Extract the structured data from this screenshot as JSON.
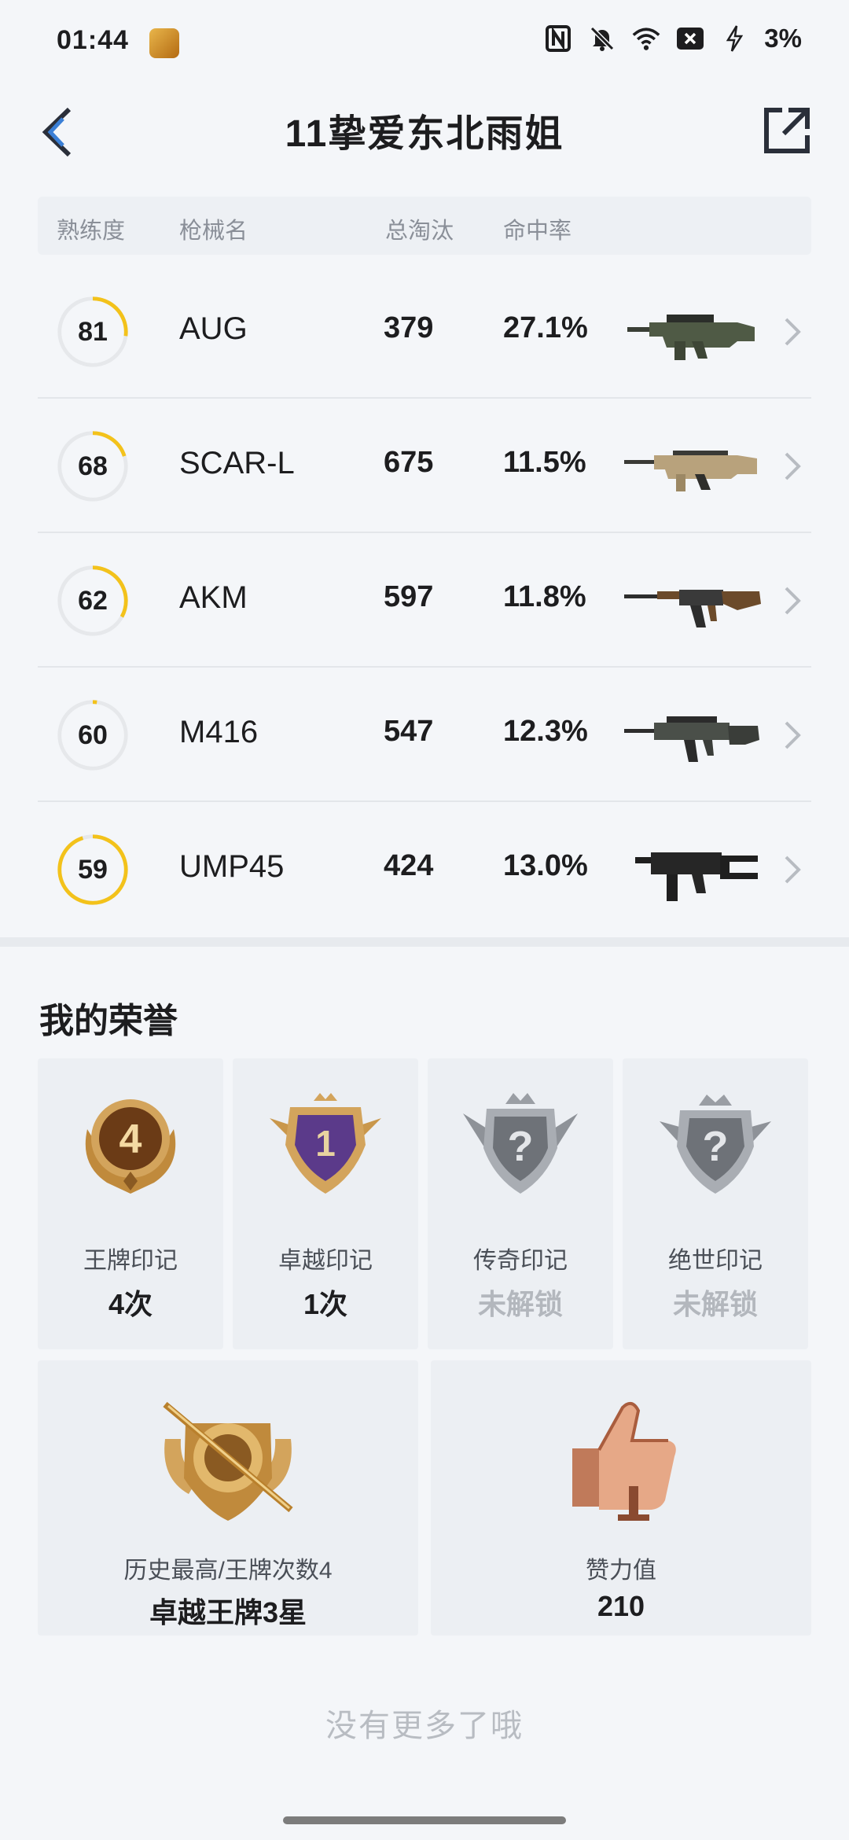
{
  "status_bar": {
    "time": "01:44",
    "battery": "3%",
    "icons": [
      "app-icon",
      "nfc-icon",
      "mute-icon",
      "wifi-icon",
      "sim-off-icon",
      "charging-icon"
    ]
  },
  "header": {
    "title": "11挚爱东北雨姐",
    "back_icon": "back-arrow-icon",
    "share_icon": "share-icon"
  },
  "weapon_table": {
    "columns": [
      "熟练度",
      "枪械名",
      "总淘汰",
      "命中率"
    ],
    "rows": [
      {
        "proficiency": "81",
        "name": "AUG",
        "kills": "379",
        "hit_rate": "27.1%"
      },
      {
        "proficiency": "68",
        "name": "SCAR-L",
        "kills": "675",
        "hit_rate": "11.5%"
      },
      {
        "proficiency": "62",
        "name": "AKM",
        "kills": "597",
        "hit_rate": "11.8%"
      },
      {
        "proficiency": "60",
        "name": "M416",
        "kills": "547",
        "hit_rate": "12.3%"
      },
      {
        "proficiency": "59",
        "name": "UMP45",
        "kills": "424",
        "hit_rate": "13.0%"
      }
    ],
    "ring_fill": [
      0.27,
      0.2,
      0.33,
      0.02,
      0.95
    ]
  },
  "honors": {
    "title": "我的荣誉",
    "cards": [
      {
        "label": "王牌印记",
        "value": "4次",
        "locked": false,
        "badge_text": "4"
      },
      {
        "label": "卓越印记",
        "value": "1次",
        "locked": false,
        "badge_text": "1"
      },
      {
        "label": "传奇印记",
        "value": "未解锁",
        "locked": true,
        "badge_text": "?"
      },
      {
        "label": "绝世印记",
        "value": "未解锁",
        "locked": true,
        "badge_text": "?"
      }
    ],
    "wide_cards": [
      {
        "label": "历史最高/王牌次数4",
        "value": "卓越王牌3星"
      },
      {
        "label": "赞力值",
        "value": "210"
      }
    ]
  },
  "footer": {
    "no_more": "没有更多了哦"
  },
  "colors": {
    "accent": "#f3c21b",
    "ring_track": "#e6e8eb",
    "background": "#f4f6f9"
  }
}
